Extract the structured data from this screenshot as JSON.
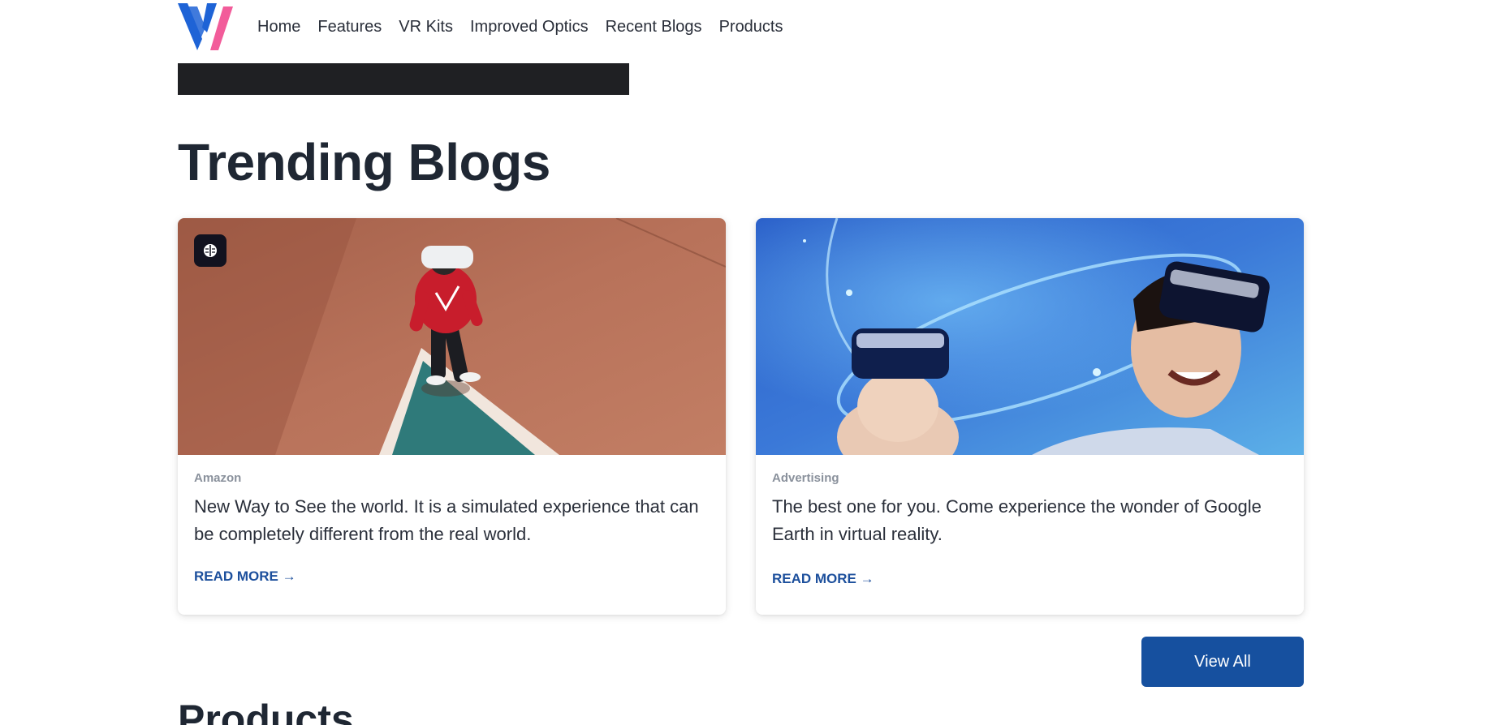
{
  "nav": {
    "links": [
      "Home",
      "Features",
      "VR Kits",
      "Improved Optics",
      "Recent Blogs",
      "Products"
    ]
  },
  "trending": {
    "title": "Trending Blogs",
    "cards": [
      {
        "category": "Amazon",
        "title": "New Way to See the world. It is a simulated experience that can be completely different from the real world.",
        "link": "READ MORE →"
      },
      {
        "category": "Advertising",
        "title": "The best one for you. Come experience the wonder of Google Earth in virtual reality.",
        "link": "READ MORE →"
      }
    ],
    "view_all": "View All"
  },
  "products": {
    "title": "Products"
  },
  "colors": {
    "accent": "#16509f",
    "link": "#1c4f9c",
    "logo_blue": "#1e63d6",
    "logo_pink": "#f25c9a"
  },
  "icons": {
    "badge": "brain-icon"
  }
}
